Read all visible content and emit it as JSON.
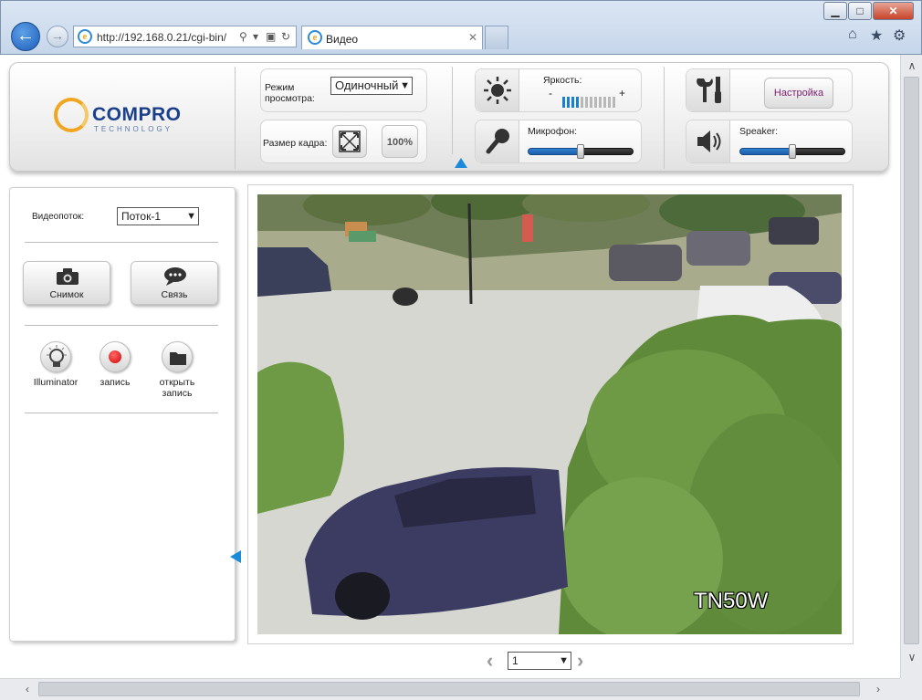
{
  "browser": {
    "window_controls": {
      "minimize": "▁",
      "maximize": "□",
      "close": "✕"
    },
    "back_icon": "←",
    "forward_icon": "→",
    "address": "http://192.168.0.21/cgi-bin/",
    "tab_title": "Видео",
    "tab_close": "✕",
    "tools": {
      "home": "⌂",
      "favorites": "★",
      "settings": "⚙"
    },
    "address_tools": {
      "search": "⚲",
      "dropdown": "▾",
      "compat": "▣",
      "refresh": "↻"
    }
  },
  "toolbar": {
    "logo_text": "COMPRO",
    "logo_sub": "TECHNOLOGY",
    "view_mode_label": "Режим просмотра:",
    "view_mode_value": "Одиночный",
    "frame_size_label": "Размер кадра:",
    "frame_fit_icon": "fit-to-frame",
    "frame_100_label": "100%",
    "brightness_label": "Яркость:",
    "brightness_minus": "-",
    "brightness_plus": "+",
    "brightness": {
      "level": 4,
      "total": 12
    },
    "microphone_label": "Микрофон:",
    "microphone_level": 0.5,
    "speaker_label": "Speaker:",
    "speaker_level": 0.5,
    "settings_label": "Настройка",
    "accent": "#1b8ad8"
  },
  "left_panel": {
    "stream_label": "Видеопоток:",
    "stream_value": "Поток-1",
    "snapshot_label": "Снимок",
    "talk_label": "Связь",
    "illuminator_label": "Illuminator",
    "record_label": "запись",
    "open_record_label": "открыть запись"
  },
  "video": {
    "watermark": "TN50W"
  },
  "pager": {
    "prev": "‹",
    "next": "›",
    "page_value": "1"
  },
  "scrollbars": {
    "up": "∧",
    "down": "∨",
    "left": "‹",
    "right": "›"
  }
}
